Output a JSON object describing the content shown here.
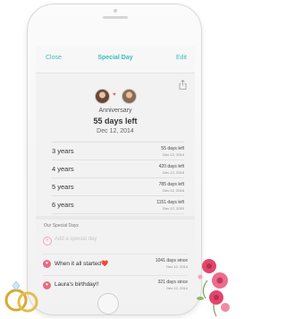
{
  "navbar": {
    "left_label": "Close",
    "title": "Special Day",
    "right_label": "Edit"
  },
  "header": {
    "label": "Anniversary",
    "days_left": "55 days left",
    "date": "Dec 12, 2014"
  },
  "years": [
    {
      "label": "3 years",
      "days": "55 days left",
      "date": "Dec 12, 2014"
    },
    {
      "label": "4 years",
      "days": "420 days left",
      "date": "Dec 12, 2015"
    },
    {
      "label": "5 years",
      "days": "785 days left",
      "date": "Dec 12, 2016"
    },
    {
      "label": "6 years",
      "days": "1151 days left",
      "date": "Dec 12, 2020"
    }
  ],
  "special": {
    "section_title": "Our Special Days",
    "add_placeholder": "Add a special day",
    "items": [
      {
        "label": "When it all started❤️",
        "days": "1041 days since",
        "date": "Dec 12, 2014"
      },
      {
        "label": "Laura's birthday!!",
        "days": "321 days since",
        "date": "Dec 12, 2014"
      }
    ]
  },
  "colors": {
    "accent": "#38bfb9",
    "pink": "#ea6a86"
  }
}
